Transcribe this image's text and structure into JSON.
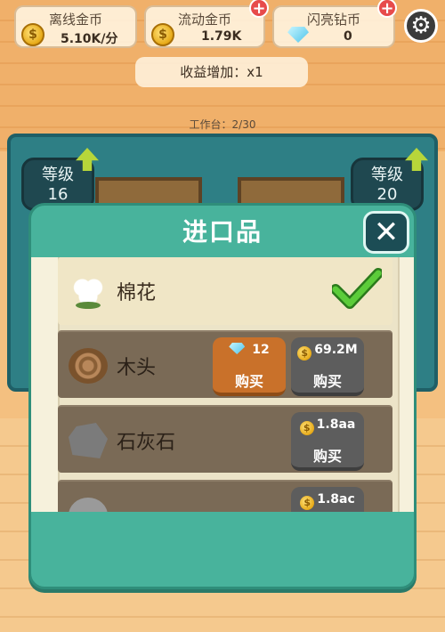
{
  "hud": {
    "offline_coins": {
      "label": "离线金币",
      "value": "5.10K/分"
    },
    "flow_coins": {
      "label": "流动金币",
      "value": "1.79K"
    },
    "diamonds": {
      "label": "闪亮钻币",
      "value": "0"
    },
    "plus_symbol": "+",
    "bonus": "收益增加：x1",
    "workbench": "工作台：2/30"
  },
  "level_badges": [
    {
      "label": "等级",
      "value": "16"
    },
    {
      "label": "等级",
      "value": "20"
    }
  ],
  "modal": {
    "title": "进口品",
    "close_symbol": "✕",
    "items": [
      {
        "name": "棉花",
        "icon": "cotton-icon",
        "status": "selected"
      },
      {
        "name": "木头",
        "icon": "wood-icon",
        "gem_price": "12",
        "gem_buy_label": "购买",
        "coin_price": "69.2M",
        "coin_buy_label": "购买"
      },
      {
        "name": "石灰石",
        "icon": "stone-icon",
        "coin_price": "1.8aa",
        "coin_buy_label": "购买"
      },
      {
        "name": "",
        "icon": "partial-item-icon",
        "coin_price": "1.8ac"
      }
    ]
  },
  "colors": {
    "modal_bg": "#48b39c",
    "close_btn": "#1c4d55",
    "gem_buy_btn": "#c9712a",
    "coin_buy_btn": "#5d5d5d",
    "checkmark": "#3fae2a"
  },
  "coin_glyph": "$"
}
